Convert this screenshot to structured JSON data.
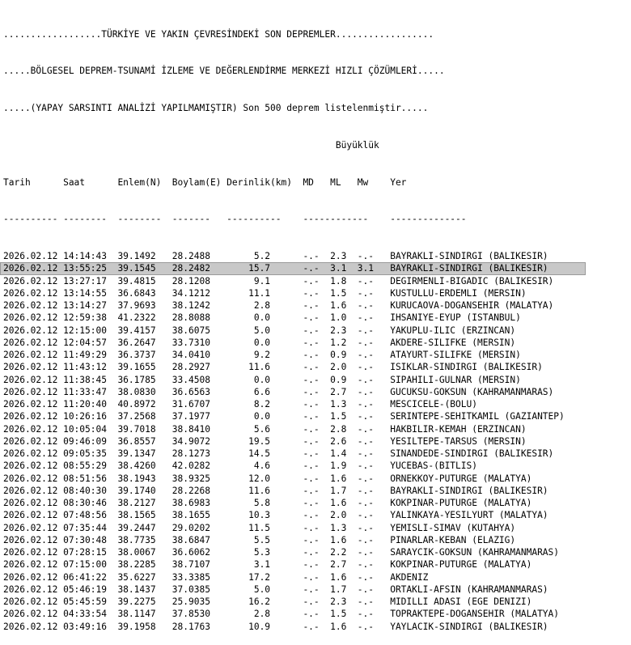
{
  "header_lines": [
    "..................TÜRKİYE VE YAKIN ÇEVRESİNDEKİ SON DEPREMLER..................",
    ".....BÖLGESEL DEPREM-TSUNAMİ İZLEME VE DEĞERLENDİRME MERKEZİ HIZLI ÇÖZÜMLERİ.....",
    ".....(YAPAY SARSINTI ANALİZİ YAPILMAMIŞTIR) Son 500 deprem listelenmiştir....."
  ],
  "columns_group_line": "                                                             Büyüklük",
  "columns_line": "Tarih      Saat      Enlem(N)  Boylam(E) Derinlik(km)  MD   ML   Mw    Yer",
  "separator_line": "---------- --------  --------  -------   ----------    ------------    --------------",
  "selected_row_index": 1,
  "rows": [
    "2026.02.12 14:14:43  39.1492   28.2488        5.2      -.-  2.3  -.-   BAYRAKLI-SINDIRGI (BALIKESIR)",
    "2026.02.12 13:55:25  39.1545   28.2482       15.7      -.-  3.1  3.1   BAYRAKLI-SINDIRGI (BALIKESIR)",
    "2026.02.12 13:27:17  39.4815   28.1208        9.1      -.-  1.8  -.-   DEGIRMENLI-BIGADIC (BALIKESIR)",
    "2026.02.12 13:14:55  36.6843   34.1212       11.1      -.-  1.5  -.-   KUSTULLU-ERDEMLI (MERSIN)",
    "2026.02.12 13:14:27  37.9693   38.1242        2.8      -.-  1.6  -.-   KURUCAOVA-DOGANSEHIR (MALATYA)",
    "2026.02.12 12:59:38  41.2322   28.8088        0.0      -.-  1.0  -.-   IHSANIYE-EYUP (ISTANBUL)",
    "2026.02.12 12:15:00  39.4157   38.6075        5.0      -.-  2.3  -.-   YAKUPLU-ILIC (ERZINCAN)",
    "2026.02.12 12:04:57  36.2647   33.7310        0.0      -.-  1.2  -.-   AKDERE-SILIFKE (MERSIN)",
    "2026.02.12 11:49:29  36.3737   34.0410        9.2      -.-  0.9  -.-   ATAYURT-SILIFKE (MERSIN)",
    "2026.02.12 11:43:12  39.1655   28.2927       11.6      -.-  2.0  -.-   ISIKLAR-SINDIRGI (BALIKESIR)",
    "2026.02.12 11:38:45  36.1785   33.4508        0.0      -.-  0.9  -.-   SIPAHILI-GULNAR (MERSIN)",
    "2026.02.12 11:33:47  38.0830   36.6563        6.6      -.-  2.7  -.-   GUCUKSU-GOKSUN (KAHRAMANMARAS)",
    "2026.02.12 11:20:40  40.8972   31.6707        8.2      -.-  1.3  -.-   MESCICELE-(BOLU)",
    "2026.02.12 10:26:16  37.2568   37.1977        0.0      -.-  1.5  -.-   SERINTEPE-SEHITKAMIL (GAZIANTEP)",
    "2026.02.12 10:05:04  39.7018   38.8410        5.6      -.-  2.8  -.-   HAKBILIR-KEMAH (ERZINCAN)",
    "2026.02.12 09:46:09  36.8557   34.9072       19.5      -.-  2.6  -.-   YESILTEPE-TARSUS (MERSIN)",
    "2026.02.12 09:05:35  39.1347   28.1273       14.5      -.-  1.4  -.-   SINANDEDE-SINDIRGI (BALIKESIR)",
    "2026.02.12 08:55:29  38.4260   42.0282        4.6      -.-  1.9  -.-   YUCEBAS-(BITLIS)",
    "2026.02.12 08:51:56  38.1943   38.9325       12.0      -.-  1.6  -.-   ORNEKKOY-PUTURGE (MALATYA)",
    "2026.02.12 08:40:30  39.1740   28.2268       11.6      -.-  1.7  -.-   BAYRAKLI-SINDIRGI (BALIKESIR)",
    "2026.02.12 08:30:46  38.2127   38.6983        5.8      -.-  1.6  -.-   KOKPINAR-PUTURGE (MALATYA)",
    "2026.02.12 07:48:56  38.1565   38.1655       10.3      -.-  2.0  -.-   YALINKAYA-YESILYURT (MALATYA)",
    "2026.02.12 07:35:44  39.2447   29.0202       11.5      -.-  1.3  -.-   YEMISLI-SIMAV (KUTAHYA)",
    "2026.02.12 07:30:48  38.7735   38.6847        5.5      -.-  1.6  -.-   PINARLAR-KEBAN (ELAZIG)",
    "2026.02.12 07:28:15  38.0067   36.6062        5.3      -.-  2.2  -.-   SARAYCIK-GOKSUN (KAHRAMANMARAS)",
    "2026.02.12 07:15:00  38.2285   38.7107        3.1      -.-  2.7  -.-   KOKPINAR-PUTURGE (MALATYA)",
    "2026.02.12 06:41:22  35.6227   33.3385       17.2      -.-  1.6  -.-   AKDENIZ",
    "2026.02.12 05:46:19  38.1437   37.0385        5.0      -.-  1.7  -.-   ORTAKLI-AFSIN (KAHRAMANMARAS)",
    "2026.02.12 05:45:59  39.2275   25.9035       16.2      -.-  2.3  -.-   MIDILLI ADASI (EGE DENIZI)",
    "2026.02.12 04:33:54  38.1147   37.8530        2.8      -.-  1.5  -.-   TOPRAKTEPE-DOGANSEHIR (MALATYA)",
    "2026.02.12 03:49:16  39.1958   28.1763       10.9      -.-  1.6  -.-   YAYLACIK-SINDIRGI (BALIKESIR)"
  ]
}
